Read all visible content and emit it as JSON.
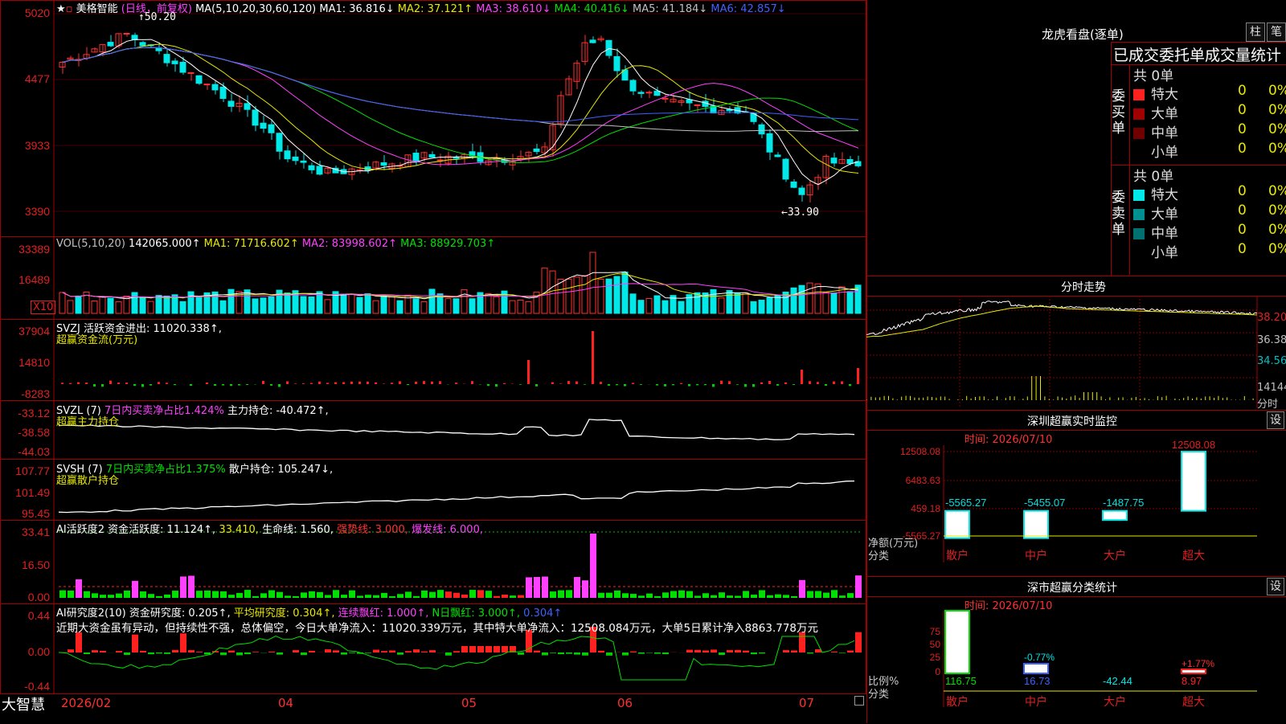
{
  "stock": {
    "name": "美格智能",
    "period": "(日线，前复权)",
    "ma_title": "MA(5,10,20,30,60,120)",
    "ma": [
      {
        "label": "MA1: 36.816↓",
        "color": "#ffffff"
      },
      {
        "label": "MA2: 37.121↑",
        "color": "#e8e800"
      },
      {
        "label": "MA3: 38.610↓",
        "color": "#ff40ff"
      },
      {
        "label": "MA4: 40.416↓",
        "color": "#00e000"
      },
      {
        "label": "MA5: 41.184↓",
        "color": "#c0c0c0"
      },
      {
        "label": "MA6: 42.857↓",
        "color": "#4060ff"
      }
    ],
    "high_marker": "50.20",
    "low_marker": "←33.90",
    "y_labels": [
      "5020",
      "4477",
      "3933",
      "3390"
    ]
  },
  "vol": {
    "title": "VOL(5,10,20)",
    "value": "142065.000↑",
    "ma1": "MA1: 71716.602↑",
    "ma2": "MA2: 83998.602↑",
    "ma3": "MA3: 88929.703↑",
    "y_labels": [
      "33389",
      "16489"
    ],
    "unit": "X10"
  },
  "svzj": {
    "title": "SVZJ  活跃资金进出: 11020.338↑,",
    "sub": "超赢资金流(万元)",
    "y_labels": [
      "37904",
      "14810",
      "-8283"
    ]
  },
  "svzl": {
    "title": "SVZL (7)",
    "ratio": "7日内买卖净占比1.424%",
    "holding": "主力持仓: -40.472↑,",
    "sub": "超赢主力持仓",
    "y_labels": [
      "-33.12",
      "-38.58",
      "-44.03"
    ]
  },
  "svsh": {
    "title": "SVSH (7)",
    "ratio": "7日内买卖净占比1.375%",
    "holding": "散户持仓: 105.247↓,",
    "sub": "超赢散户持仓",
    "y_labels": [
      "107.77",
      "101.49",
      "95.45"
    ]
  },
  "ai1": {
    "title": "AI活跃度2",
    "l1": "资金活跃度: 11.124↑,",
    "l2": "33.410,",
    "l3": "生命线: 1.560,",
    "l4": "强势线: 3.000,",
    "l5": "爆发线: 6.000,",
    "y_labels": [
      "33.41",
      "16.50",
      "0.00"
    ]
  },
  "ai2": {
    "title": "AI研究度2(10)",
    "l1": "资金研究度: 0.205↑,",
    "l2": "平均研究度: 0.304↑,",
    "l3": "连续飘红: 1.000↑,",
    "l4": "N日飘红: 3.000↑,",
    "l5": "0.304↑",
    "comment": "近期大资金虽有异动，但持续性不强，总体偏空，今日大单净流入：11020.339万元，其中特大单净流入：12508.084万元，大单5日累计净入8863.778万元",
    "y_labels": [
      "0.44",
      "0.00",
      "-0.44"
    ]
  },
  "xaxis": {
    "brand": "大智慧",
    "labels": [
      "2026/02",
      "04",
      "05",
      "06",
      "07"
    ]
  },
  "lhb": {
    "title": "龙虎看盘(逐单)",
    "btn1": "柱",
    "btn2": "笔",
    "tabs": "已成交委托单成交量统计",
    "buy_side": "委买单",
    "sell_side": "委卖单",
    "buy_count": "共 0单",
    "sell_count": "共 0单",
    "rows": [
      {
        "label": "特大",
        "v": "0",
        "p": "0%",
        "color": "#ff2020"
      },
      {
        "label": "大单",
        "v": "0",
        "p": "0%",
        "color": "#a00000"
      },
      {
        "label": "中单",
        "v": "0",
        "p": "0%",
        "color": "#700000"
      },
      {
        "label": "小单",
        "v": "0",
        "p": "0%",
        "color": ""
      }
    ],
    "rows_sell": [
      {
        "label": "特大",
        "v": "0",
        "p": "0%",
        "color": "#00e8e8"
      },
      {
        "label": "大单",
        "v": "0",
        "p": "0%",
        "color": "#009090"
      },
      {
        "label": "中单",
        "v": "0",
        "p": "0%",
        "color": "#007070"
      },
      {
        "label": "小单",
        "v": "0",
        "p": "0%",
        "color": ""
      }
    ]
  },
  "fenshi": {
    "title": "分时走势",
    "y_labels": [
      "38.20",
      "36.38",
      "34.56",
      "14144"
    ],
    "unit": "分时"
  },
  "monitor": {
    "title": "深圳超赢实时监控",
    "set": "设",
    "time": "时间: 2026/07/10",
    "y_labels": [
      "12508.08",
      "6483.63",
      "459.18",
      "-5565.27"
    ],
    "axis_name": "净额(万元)",
    "axis_cat": "分类",
    "cats": [
      "散户",
      "中户",
      "大户",
      "超大"
    ],
    "values": [
      "-5565.27",
      "-5455.07",
      "-1487.75",
      "12508.08"
    ]
  },
  "classify": {
    "title": "深市超赢分类统计",
    "set": "设",
    "time": "时间: 2026/07/10",
    "y_labels": [
      "75",
      "50",
      "25",
      "0"
    ],
    "axis_name": "比例%",
    "axis_cat": "分类",
    "pcts": [
      "-0.77%",
      "+1.77%"
    ],
    "values": [
      "116.75",
      "16.73",
      "-42.44",
      "8.97"
    ],
    "cats": [
      "散户",
      "中户",
      "大户",
      "超大"
    ]
  }
}
